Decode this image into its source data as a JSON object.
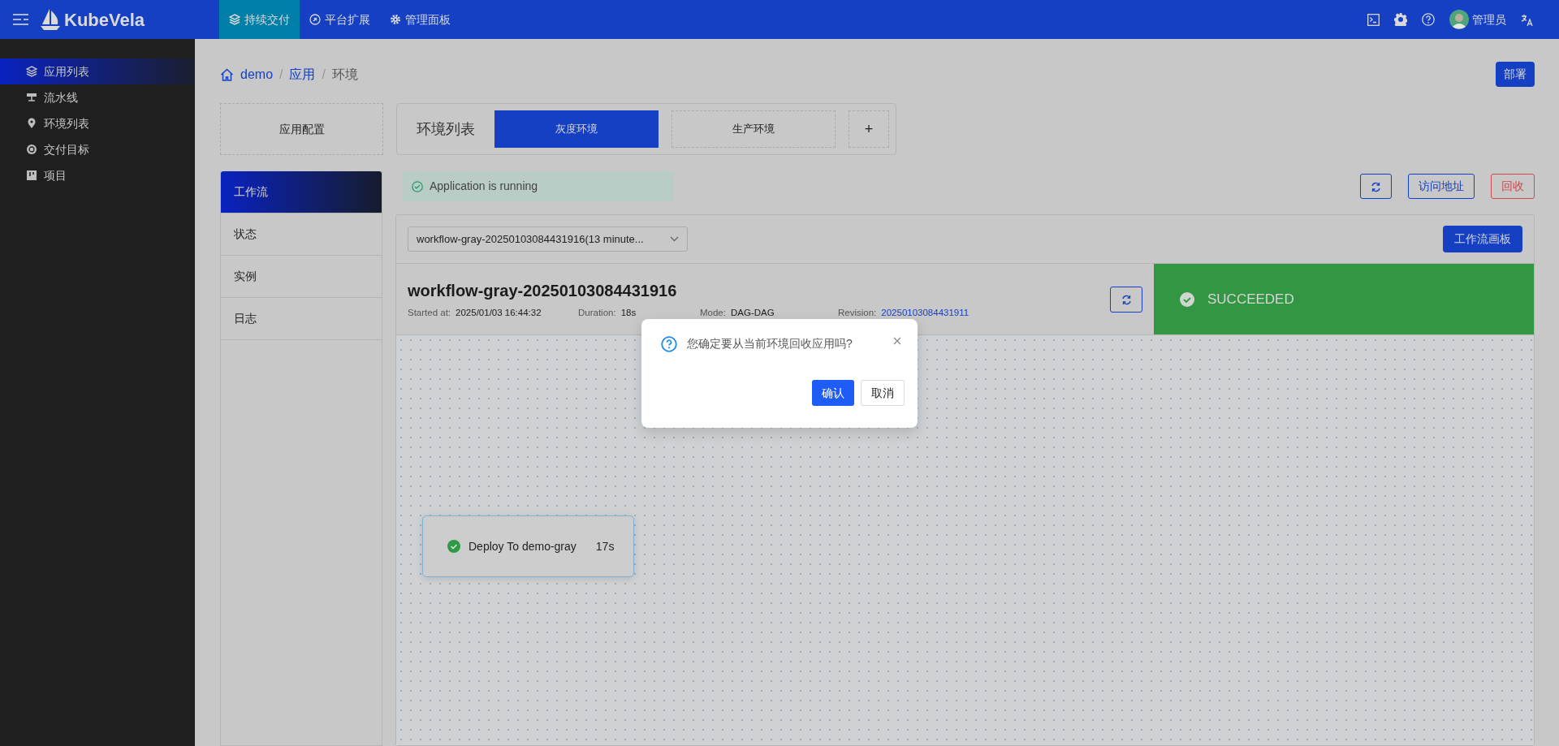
{
  "topbar": {
    "brand": "KubeVela",
    "nav": [
      {
        "label": "持续交付",
        "selected": true
      },
      {
        "label": "平台扩展",
        "selected": false
      },
      {
        "label": "管理面板",
        "selected": false
      }
    ],
    "user": "管理员"
  },
  "sidebar": {
    "items": [
      {
        "label": "应用列表",
        "selected": true
      },
      {
        "label": "流水线",
        "selected": false
      },
      {
        "label": "环境列表",
        "selected": false
      },
      {
        "label": "交付目标",
        "selected": false
      },
      {
        "label": "项目",
        "selected": false
      }
    ]
  },
  "breadcrumb": [
    {
      "label": "demo"
    },
    {
      "separator": "/",
      "label": "应用"
    },
    {
      "separator": "/",
      "label": "环境"
    }
  ],
  "deploy_button": "部署",
  "app_config": "应用配置",
  "env_list": {
    "title": "环境列表",
    "tabs": [
      {
        "label": "灰度环境",
        "selected": true
      },
      {
        "label": "生产环境",
        "selected": false
      }
    ],
    "add": "+"
  },
  "side_tabs": [
    {
      "label": "工作流",
      "selected": true
    },
    {
      "label": "状态",
      "selected": false
    },
    {
      "label": "实例",
      "selected": false
    },
    {
      "label": "日志",
      "selected": false
    }
  ],
  "alert": "Application is running",
  "actions": [
    {
      "label": "访问地址",
      "kind": "default"
    },
    {
      "label": "回收",
      "kind": "danger"
    }
  ],
  "workflow_select": "workflow-gray-20250103084431916(13 minute...",
  "workflow_board_button": "工作流画板",
  "workflow": {
    "name": "workflow-gray-20250103084431916",
    "meta": [
      {
        "label": "Started at:",
        "value": "2025/01/03 16:44:32",
        "kind": "text"
      },
      {
        "label": "Duration:",
        "value": "18s",
        "kind": "text"
      },
      {
        "label": "Mode:",
        "value": "DAG-DAG",
        "kind": "text"
      },
      {
        "label": "Revision:",
        "value": "20250103084431911",
        "kind": "link"
      }
    ],
    "status": "SUCCEEDED"
  },
  "steps": [
    {
      "name": "Deploy To demo-gray",
      "duration": "17s"
    }
  ],
  "dialog": {
    "message": "您确定要从当前环境回收应用吗?",
    "buttons": [
      {
        "label": "确认",
        "kind": "primary"
      },
      {
        "label": "取消",
        "kind": "default"
      }
    ]
  }
}
